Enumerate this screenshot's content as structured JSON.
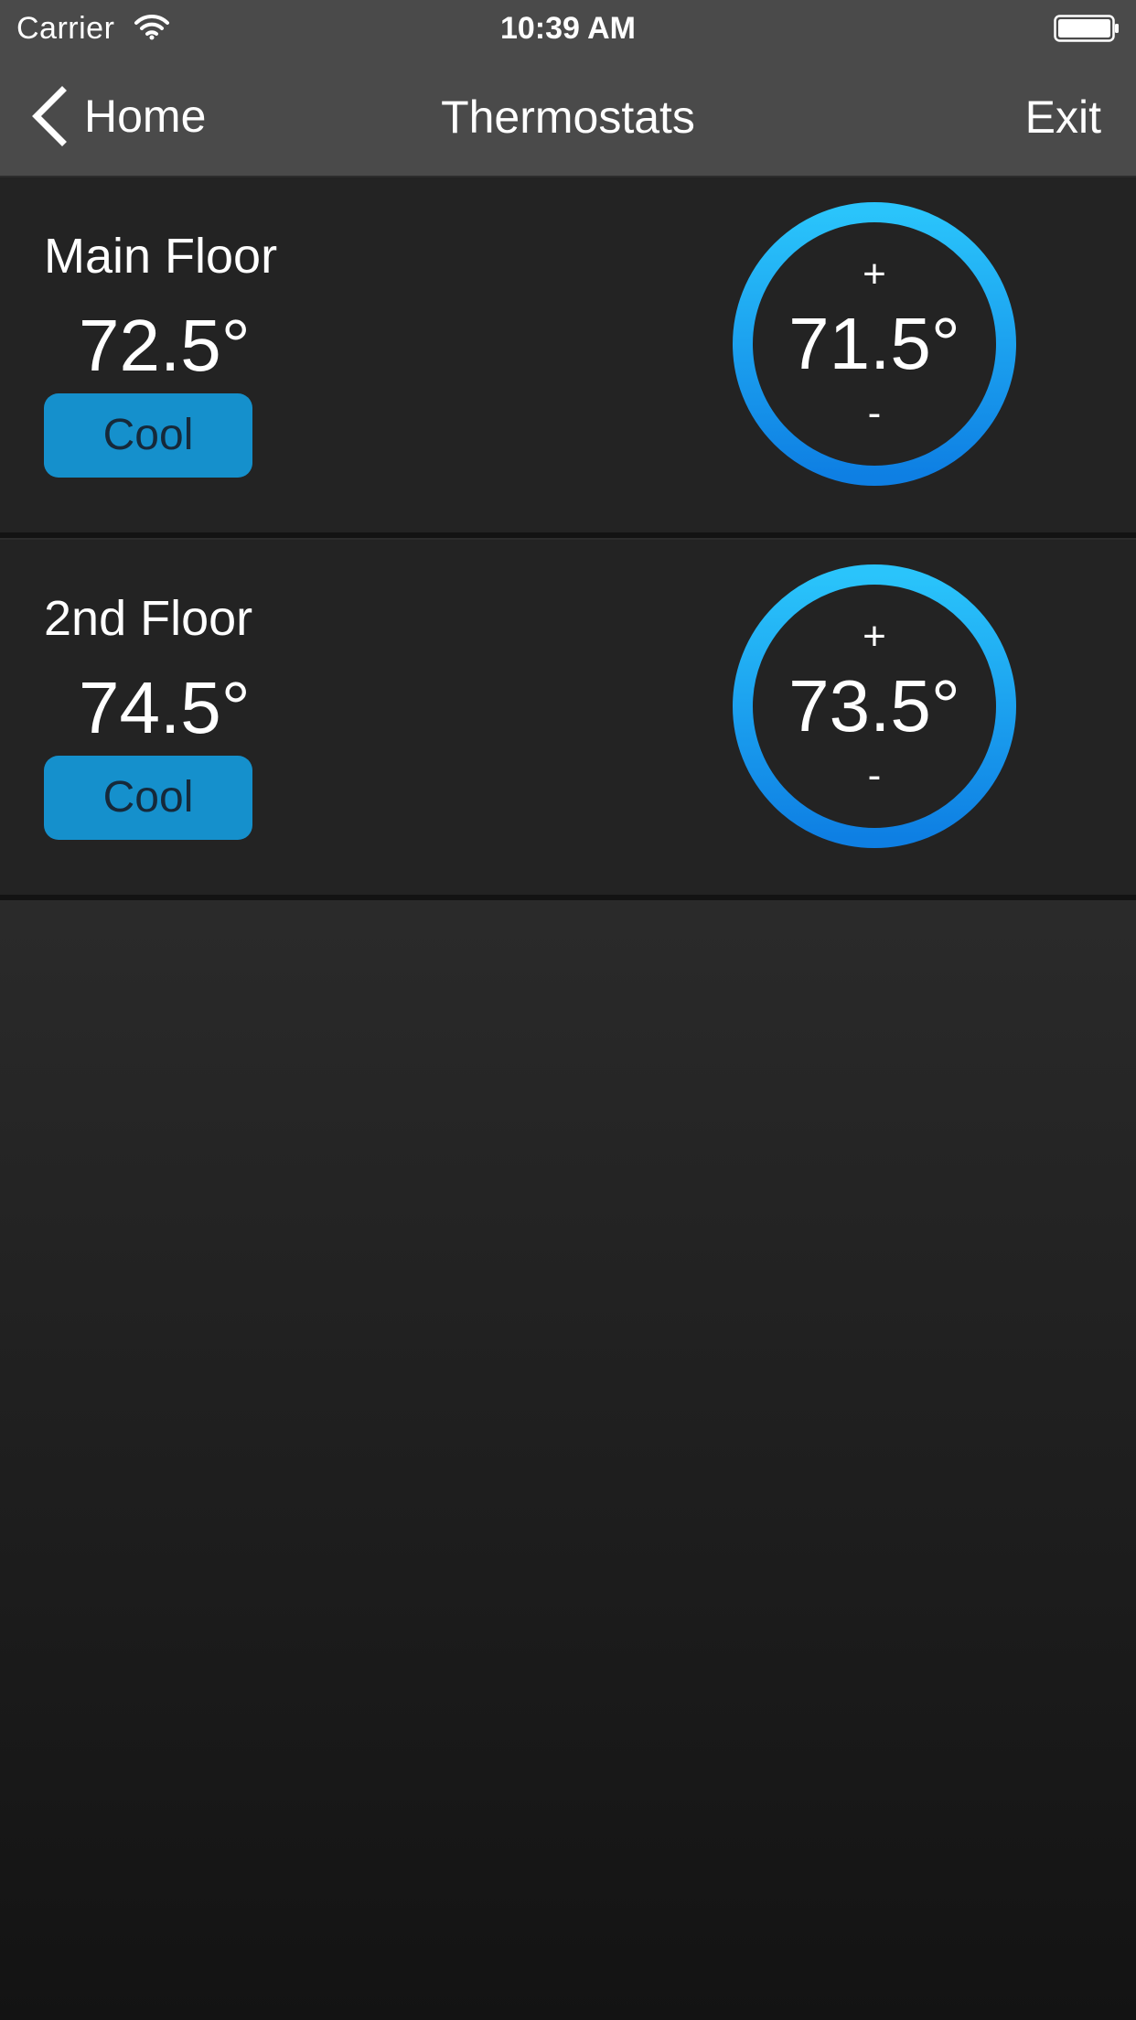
{
  "status_bar": {
    "carrier": "Carrier",
    "time": "10:39 AM"
  },
  "nav": {
    "back_label": "Home",
    "title": "Thermostats",
    "exit_label": "Exit"
  },
  "thermostats": [
    {
      "name": "Main Floor",
      "current_temp": "72.5°",
      "mode": "Cool",
      "setpoint": "71.5°",
      "increase_label": "+",
      "decrease_label": "-"
    },
    {
      "name": "2nd Floor",
      "current_temp": "74.5°",
      "mode": "Cool",
      "setpoint": "73.5°",
      "increase_label": "+",
      "decrease_label": "-"
    }
  ],
  "colors": {
    "accent": "#1590cc",
    "ring_top": "#2ac4fb",
    "ring_bottom": "#0e7fe3",
    "card_background": "#232323",
    "nav_background": "#4a4a4a"
  }
}
